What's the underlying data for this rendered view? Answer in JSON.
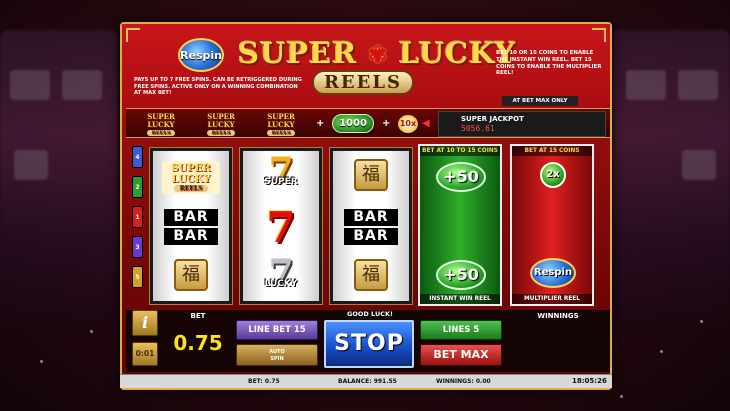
{
  "header": {
    "respin_badge": "Respin",
    "logo_line1_a": "SUPER",
    "logo_line1_b": "LUCKY",
    "logo_line2": "REELS",
    "info_left": "PAYS UP TO 7 FREE SPINS. CAN BE RETRIGGERED DURING FREE SPINS. ACTIVE ONLY ON A WINNING COMBINATION AT MAX BET!",
    "info_right": "BET 10 OR 15 COINS TO ENABLE THE INSTANT WIN REEL. BET 15 COINS TO ENABLE THE MULTIPLIER REEL!",
    "at_bet_max": "AT BET MAX ONLY"
  },
  "paybar": {
    "mini_logo_a": "SUPER",
    "mini_logo_b": "LUCKY",
    "mini_logo_r": "REELS",
    "plus": "+",
    "coin_value": "1000",
    "multiplier": "10x",
    "jackpot_label": "SUPER JACKPOT",
    "jackpot_value": "5056.61"
  },
  "markers": [
    {
      "label": "4",
      "color": "#3a5ad8"
    },
    {
      "label": "2",
      "color": "#2aa02a"
    },
    {
      "label": "1",
      "color": "#d82020"
    },
    {
      "label": "3",
      "color": "#6a3ad8"
    },
    {
      "label": "5",
      "color": "#d8a020"
    }
  ],
  "reels": {
    "reel1": {
      "bar_top": "BAR",
      "bar_bottom": "BAR",
      "fu": "福"
    },
    "reel2": {
      "seven_top_label": "SUPER",
      "seven_bottom_label": "LUCKY",
      "seven": "7"
    },
    "reel3": {
      "fu_top": "福",
      "bar_top": "BAR",
      "bar_bottom": "BAR",
      "fu_bottom": "福"
    }
  },
  "instant_reel": {
    "top_label": "BET AT 10 TO 15 COINS",
    "coin_top": "+50",
    "coin_bottom": "+50",
    "bottom_label": "INSTANT WIN REEL"
  },
  "multiplier_reel": {
    "top_label": "BET AT 15 COINS",
    "mult": "2x",
    "respin": "Respin",
    "bottom_label": "MULTIPLIER REEL"
  },
  "panel": {
    "info_btn": "i",
    "timer": "0:01",
    "bet_label": "BET",
    "bet_value": "0.75",
    "line_bet": "LINE BET 15",
    "autospin_a": "AUTO",
    "autospin_b": "SPIN",
    "good_luck": "GOOD LUCK!",
    "stop": "STOP",
    "lines": "LINES 5",
    "bet_max": "BET MAX",
    "winnings_label": "WINNINGS"
  },
  "status": {
    "bet": "BET: 0.75",
    "balance": "BALANCE: 991.55",
    "winnings": "WINNINGS: 0.00",
    "clock": "18:05:26"
  }
}
